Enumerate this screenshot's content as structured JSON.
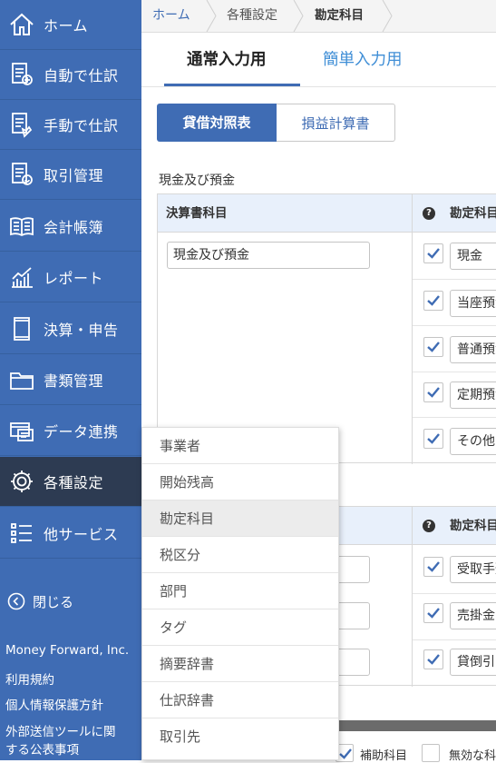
{
  "sidebar": {
    "items": [
      {
        "label": "ホーム",
        "icon": "home-icon"
      },
      {
        "label": "自動で仕訳",
        "icon": "auto-journal-icon"
      },
      {
        "label": "手動で仕訳",
        "icon": "manual-journal-icon"
      },
      {
        "label": "取引管理",
        "icon": "transaction-icon"
      },
      {
        "label": "会計帳簿",
        "icon": "ledger-book-icon"
      },
      {
        "label": "レポート",
        "icon": "report-chart-icon"
      },
      {
        "label": "決算・申告",
        "icon": "settlement-icon"
      },
      {
        "label": "書類管理",
        "icon": "folder-icon"
      },
      {
        "label": "データ連携",
        "icon": "data-link-icon"
      },
      {
        "label": "各種設定",
        "icon": "gear-icon"
      },
      {
        "label": "他サービス",
        "icon": "list-icon"
      }
    ],
    "active_index": 9,
    "close_label": "閉じる",
    "footer": {
      "company": "Money Forward, Inc.",
      "terms": "利用規約",
      "privacy": "個人情報保護方針",
      "external_line1": "外部送信ツールに関",
      "external_line2": "する公表事項"
    }
  },
  "breadcrumb": [
    "ホーム",
    "各種設定",
    "勘定科目"
  ],
  "tabs": {
    "normal": "通常入力用",
    "simple": "簡単入力用",
    "active": "normal"
  },
  "statement_toggle": {
    "balance_sheet": "貸借対照表",
    "income_statement": "損益計算書",
    "active": "balance_sheet"
  },
  "section1": {
    "title": "現金及び預金",
    "col_statement_item": "決算書科目",
    "col_account": "勘定科目",
    "statement_value": "現金及び預金",
    "accounts": [
      "現金",
      "当座預金",
      "普通預金",
      "定期預金",
      "その他の預金"
    ],
    "checked": [
      true,
      true,
      true,
      true,
      true
    ]
  },
  "section2": {
    "col_account": "勘定科目",
    "accounts": [
      "受取手形",
      "売掛金",
      "貸倒引当金"
    ],
    "checked": [
      true,
      true,
      true
    ]
  },
  "bottom_row": {
    "sub_account": "補助科目",
    "invalid": "無効な科目"
  },
  "submenu": {
    "items": [
      "事業者",
      "開始残高",
      "勘定科目",
      "税区分",
      "部門",
      "タグ",
      "摘要辞書",
      "仕訳辞書",
      "取引先"
    ],
    "active_index": 2
  },
  "colors": {
    "brand": "#3f6cb4",
    "active_nav": "#2d3b52",
    "header_bg": "#e8f0fb"
  }
}
